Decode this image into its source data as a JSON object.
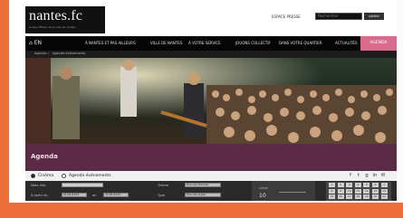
{
  "site": {
    "logo": "nantes.fc",
    "tagline": "le site officiel de la ville de nantes",
    "lang": "EN"
  },
  "topbar": {
    "espace_presse": "ESPACE PRESSE",
    "search_placeholder": "Rechercher",
    "search_button": "valider"
  },
  "nav": {
    "items": [
      "À NANTES ET PAS AILLEURS",
      "VILLE DE NANTES",
      "À VOTRE SERVICE",
      "JOUONS COLLECTIF",
      "DANS VOTRE QUARTIER",
      "ACTUALITÉS",
      "AGENDA"
    ]
  },
  "breadcrumb": {
    "home": "Agenda",
    "sep": ">",
    "current": "Agenda évènements"
  },
  "agenda": {
    "title": "Agenda"
  },
  "filters": {
    "option1": "Cinéma",
    "option2": "Agenda évènements"
  },
  "social": [
    "f",
    "t",
    "g",
    "in",
    "✉"
  ],
  "search_form": {
    "mots_cles": "Mots clés",
    "a_partir_du": "À partir du",
    "au": "au",
    "theme": "Thème",
    "type": "Type",
    "theme_value": "Tous les thèmes",
    "type_value": "Tous les types",
    "from_value": "01/01/2013",
    "to_value": "31/01/2013"
  },
  "date_panel": {
    "month": "Lundi",
    "day": "10"
  },
  "calendar": {
    "rows": [
      [
        "1",
        "2",
        "3",
        "4",
        "5",
        "6",
        "7"
      ],
      [
        "8",
        "9",
        "10",
        "11",
        "12",
        "13",
        "14"
      ],
      [
        "15",
        "16",
        "17",
        "18",
        "19",
        "20",
        "21"
      ]
    ]
  },
  "colors": {
    "accent_orange": "#ec6e3b",
    "agenda_purple": "#5b2a44",
    "nav_active": "#d96b8e"
  }
}
